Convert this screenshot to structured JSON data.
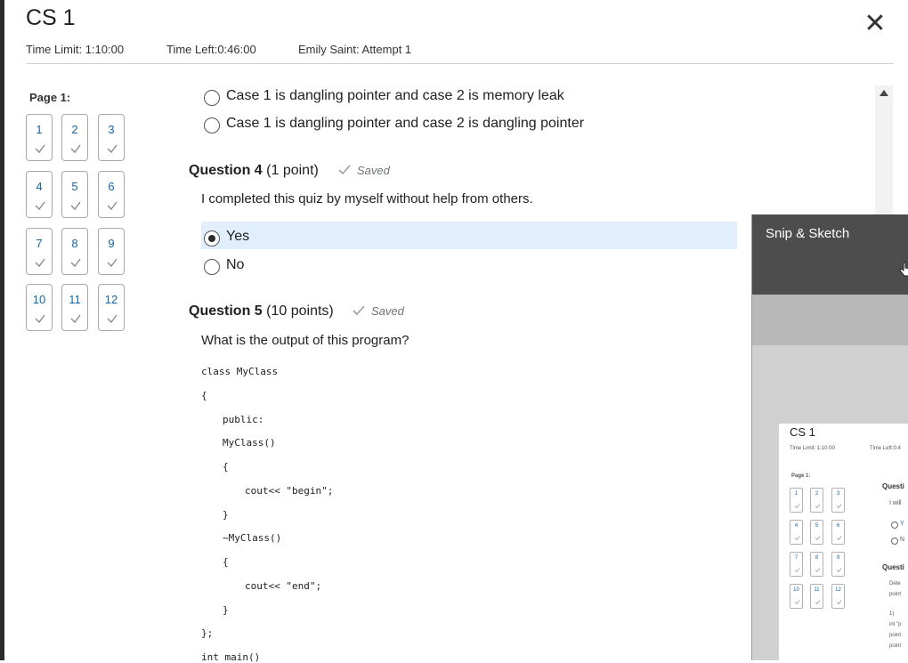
{
  "quiz": {
    "title": "CS 1",
    "close_icon": "close-x-icon",
    "time_limit": "Time Limit: 1:10:00",
    "time_left": "Time Left:0:46:00",
    "attempt": "Emily Saint: Attempt 1"
  },
  "nav": {
    "page_label": "Page 1:",
    "questions": [
      "1",
      "2",
      "3",
      "4",
      "5",
      "6",
      "7",
      "8",
      "9",
      "10",
      "11",
      "12"
    ],
    "status_icon": "checkmark-icon"
  },
  "q3": {
    "options": [
      "Case 1 is dangling pointer and case 2 is memory leak",
      "Case 1 is dangling pointer and case 2 is dangling pointer"
    ]
  },
  "q4": {
    "label": "Question 4",
    "points": "(1 point)",
    "status": "Saved",
    "text": "I completed this quiz by myself without help from others.",
    "options": [
      "Yes",
      "No"
    ],
    "selected": "Yes"
  },
  "q5": {
    "label": "Question 5",
    "points": "(10 points)",
    "status": "Saved",
    "text": "What is the output of this program?",
    "code": [
      "class MyClass",
      "{",
      "public:",
      "MyClass()",
      "{",
      "cout<< \"begin\";",
      "}",
      "~MyClass()",
      "{",
      "cout<< \"end\";",
      "}",
      "};",
      "int main()"
    ]
  },
  "snip": {
    "title": "Snip & Sketch",
    "thumb": {
      "title": "CS 1",
      "time_limit": "Time Limit: 1:10:00",
      "time_left": "Time Left:0:4",
      "page_label": "Page 1:",
      "questions": [
        "1",
        "2",
        "3",
        "4",
        "5",
        "6",
        "7",
        "8",
        "9",
        "10",
        "11",
        "12"
      ],
      "q_label_1": "Questi",
      "line_1": "I will",
      "opt_1": "Y",
      "opt_2": "N",
      "q_label_2": "Questi",
      "line_2": "Dete",
      "line_3": "point",
      "line_4": "1)",
      "line_5": "int \"p",
      "line_6": "point",
      "line_7": "point"
    }
  },
  "colors": {
    "link_blue": "#1466a6",
    "selected_bg": "#e1eefb",
    "snip_header": "#4d4d4d"
  }
}
